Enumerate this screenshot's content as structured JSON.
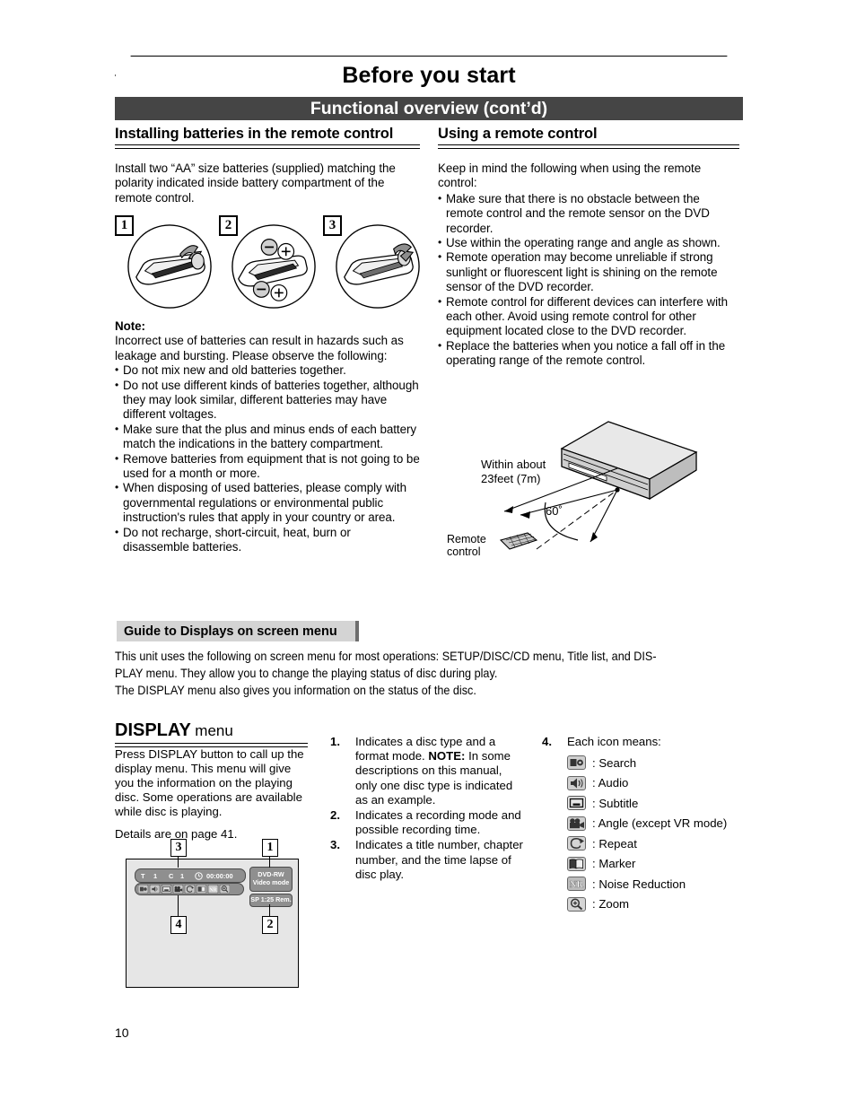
{
  "page": {
    "chapter_title": "Before you start",
    "section_bar": "Functional overview (cont’d)",
    "page_number": "10"
  },
  "left_column": {
    "heading": "Installing batteries in the remote control",
    "intro": "Install two “AA” size batteries (supplied) matching the polarity indicated inside battery compartment of the remote control.",
    "figures": [
      {
        "number": "1"
      },
      {
        "number": "2"
      },
      {
        "number": "3"
      }
    ],
    "note_label": "Note:",
    "note_intro": "Incorrect use of batteries can result in hazards such as leakage and bursting. Please observe the following:",
    "note_bullets": [
      "Do not mix new and old batteries together.",
      "Do not use different kinds of batteries together, although they may look similar, different batteries may have different voltages.",
      "Make sure that the plus and minus ends of each battery match the indications in the battery compartment.",
      "Remove batteries from equipment that is not going to be used for a month or more.",
      "When disposing of used batteries, please comply with governmental regulations or environmental public instruction's rules that apply in your country or area.",
      "Do not recharge, short-circuit, heat, burn or disassemble batteries."
    ]
  },
  "right_column": {
    "heading": "Using a remote control",
    "intro": "Keep in mind the following when using the remote control:",
    "bullets": [
      "Make sure that there is no obstacle between the remote control and the remote sensor on the DVD recorder.",
      "Use within the operating range and angle as shown.",
      "Remote operation may become unreliable if strong sunlight or fluorescent light is shining on the remote sensor of the DVD recorder.",
      "Remote control for different devices can interfere with each other.  Avoid using remote control for other equipment located close to the DVD recorder.",
      "Replace the batteries when you notice a fall off in the operating range of the remote control."
    ],
    "range_diagram": {
      "distance_label_line1": "Within about",
      "distance_label_line2": "23feet (7m)",
      "angle_label": "60˚",
      "remote_label_line1": "Remote",
      "remote_label_line2": "control"
    }
  },
  "guide_section": {
    "bar_title": "Guide to Displays on screen menu",
    "paragraph1": "This unit uses the following on screen menu for most operations: SETUP/DISC/CD menu, Title list, and DIS-",
    "paragraph2": "PLAY menu. They allow you to change the playing status of disc during play.",
    "paragraph3": "The DISPLAY menu also gives you information on the status of the disc."
  },
  "display_menu": {
    "title_bold": "DISPLAY",
    "title_light": "menu",
    "paragraph1": "Press DISPLAY button to call up the display menu. This menu will give you the information on the playing disc. Some operations are available while disc is playing.",
    "paragraph2": "Details are on page 41.",
    "osd": {
      "callouts": [
        "3",
        "1",
        "4",
        "2"
      ],
      "title_marker": "T",
      "title_number": "1",
      "chapter_marker": "C",
      "chapter_number": "1",
      "time": "00:00:00",
      "disc_type": "DVD-RW",
      "format_mode": "Video mode",
      "record_mode": "SP 1:25 Rem."
    }
  },
  "numbered_items": [
    {
      "number": "1.",
      "text": "Indicates a disc type and a format mode.",
      "note_label": "NOTE:",
      "note_text": " In some descriptions on this manual, only one disc type is indicated as an example."
    },
    {
      "number": "2.",
      "text": "Indicates a recording mode and possible recording time."
    },
    {
      "number": "3.",
      "text": "Indicates a title number, chapter number, and the time lapse of disc play."
    }
  ],
  "icon_legend": {
    "number": "4.",
    "heading": "Each icon means:",
    "items": [
      {
        "icon": "search-icon",
        "label": ": Search"
      },
      {
        "icon": "audio-icon",
        "label": ": Audio"
      },
      {
        "icon": "subtitle-icon",
        "label": ": Subtitle"
      },
      {
        "icon": "angle-icon",
        "label": ": Angle (except VR mode)"
      },
      {
        "icon": "repeat-icon",
        "label": ": Repeat"
      },
      {
        "icon": "marker-icon",
        "label": ": Marker"
      },
      {
        "icon": "noise-reduction-icon",
        "label": ": Noise Reduction"
      },
      {
        "icon": "zoom-icon",
        "label": ": Zoom"
      }
    ]
  },
  "colors": {
    "section_bar": "#454545",
    "guide_bar": "#d4d4d4",
    "osd_bg": "#e6e6e6",
    "osd_widget": "#8f8f8f"
  }
}
